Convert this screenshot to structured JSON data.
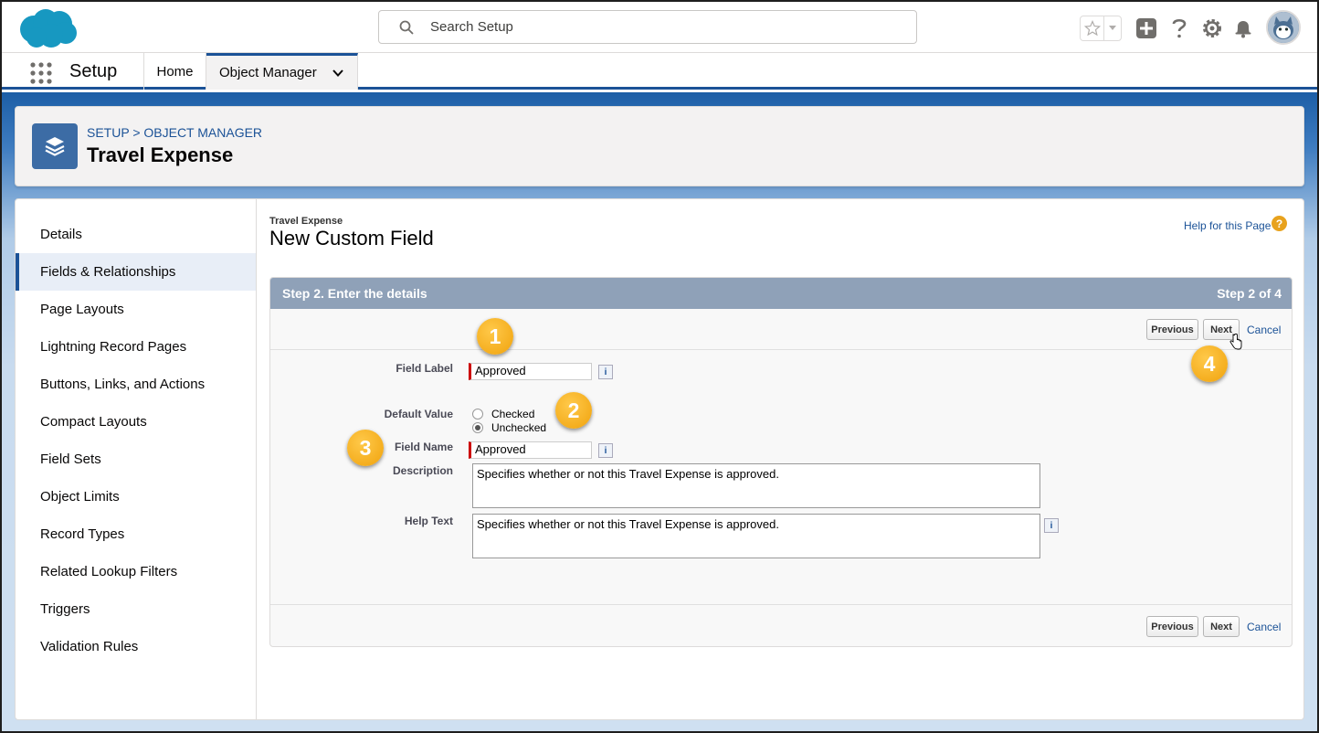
{
  "header": {
    "search": {
      "placeholder": "Search Setup"
    },
    "icons": [
      "salesforce-logo",
      "star-icon",
      "chevron-down-icon",
      "plus-icon",
      "question-icon",
      "gear-icon",
      "bell-icon",
      "avatar"
    ]
  },
  "nav": {
    "app_name": "Setup",
    "tabs": [
      {
        "label": "Home"
      },
      {
        "label": "Object Manager"
      }
    ]
  },
  "page_header": {
    "breadcrumb": "SETUP > OBJECT MANAGER",
    "title": "Travel Expense"
  },
  "sidebar": {
    "items": [
      {
        "label": "Details"
      },
      {
        "label": "Fields & Relationships",
        "active": true
      },
      {
        "label": "Page Layouts"
      },
      {
        "label": "Lightning Record Pages"
      },
      {
        "label": "Buttons, Links, and Actions"
      },
      {
        "label": "Compact Layouts"
      },
      {
        "label": "Field Sets"
      },
      {
        "label": "Object Limits"
      },
      {
        "label": "Record Types"
      },
      {
        "label": "Related Lookup Filters"
      },
      {
        "label": "Triggers"
      },
      {
        "label": "Validation Rules"
      }
    ]
  },
  "content": {
    "object_label": "Travel Expense",
    "title": "New Custom Field",
    "help_link": "Help for this Page",
    "help_icon": "?",
    "step_title": "Step 2. Enter the details",
    "step_count": "Step 2 of 4",
    "buttons": {
      "previous": "Previous",
      "next": "Next",
      "cancel": "Cancel"
    },
    "info_glyph": "i",
    "form": {
      "field_label": {
        "label": "Field Label",
        "value": "Approved"
      },
      "default_value": {
        "label": "Default Value",
        "options": [
          "Checked",
          "Unchecked"
        ],
        "selected": "Unchecked"
      },
      "field_name": {
        "label": "Field Name",
        "value": "Approved"
      },
      "description": {
        "label": "Description",
        "value": "Specifies whether or not this Travel Expense is approved."
      },
      "help_text": {
        "label": "Help Text",
        "value": "Specifies whether or not this Travel Expense is approved."
      }
    }
  },
  "callouts": [
    "1",
    "2",
    "3",
    "4"
  ],
  "colors": {
    "brand_blue": "#1b5297",
    "callout": "#f0a20c",
    "required": "#cc0000",
    "step_header": "#8fa1b8"
  }
}
